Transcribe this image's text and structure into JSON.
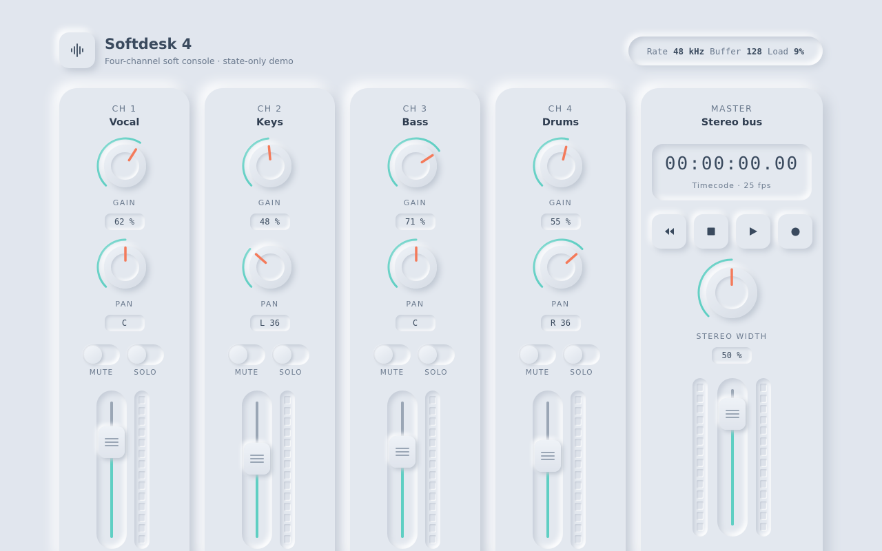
{
  "app": {
    "logo_icon": "waveform-icon",
    "title": "Softdesk 4",
    "subtitle": "Four-channel soft console · state-only demo"
  },
  "stats": {
    "rate_label": "Rate",
    "rate_value": "48 kHz",
    "buffer_label": "Buffer",
    "buffer_value": "128",
    "load_label": "Load",
    "load_value": "9%"
  },
  "labels": {
    "gain": "GAIN",
    "pan": "PAN",
    "mute": "MUTE",
    "solo": "SOLO"
  },
  "colors": {
    "accent": "#5fcfc3",
    "indicator": "#f47a5a",
    "background": "#e1e6ee"
  },
  "channels": [
    {
      "num": "CH 1",
      "name": "Vocal",
      "gain": 0.62,
      "gain_text": "62 %",
      "pan": 0,
      "pan_text": "C",
      "mute": false,
      "solo": false,
      "fader": 0.7
    },
    {
      "num": "CH 2",
      "name": "Keys",
      "gain": 0.48,
      "gain_text": "48 %",
      "pan": -0.36,
      "pan_text": "L 36",
      "mute": false,
      "solo": false,
      "fader": 0.58
    },
    {
      "num": "CH 3",
      "name": "Bass",
      "gain": 0.71,
      "gain_text": "71 %",
      "pan": 0,
      "pan_text": "C",
      "mute": false,
      "solo": false,
      "fader": 0.63
    },
    {
      "num": "CH 4",
      "name": "Drums",
      "gain": 0.55,
      "gain_text": "55 %",
      "pan": 0.36,
      "pan_text": "R 36",
      "mute": false,
      "solo": false,
      "fader": 0.6
    }
  ],
  "master": {
    "num": "MASTER",
    "name": "Stereo bus",
    "timecode": "00:00:00.00",
    "timecode_label": "Timecode · 25 fps",
    "transport": [
      "rewind-icon",
      "stop-icon",
      "play-icon",
      "record-icon"
    ],
    "width_label": "STEREO WIDTH",
    "width": 0.5,
    "width_text": "50 %",
    "fader": 0.82
  }
}
